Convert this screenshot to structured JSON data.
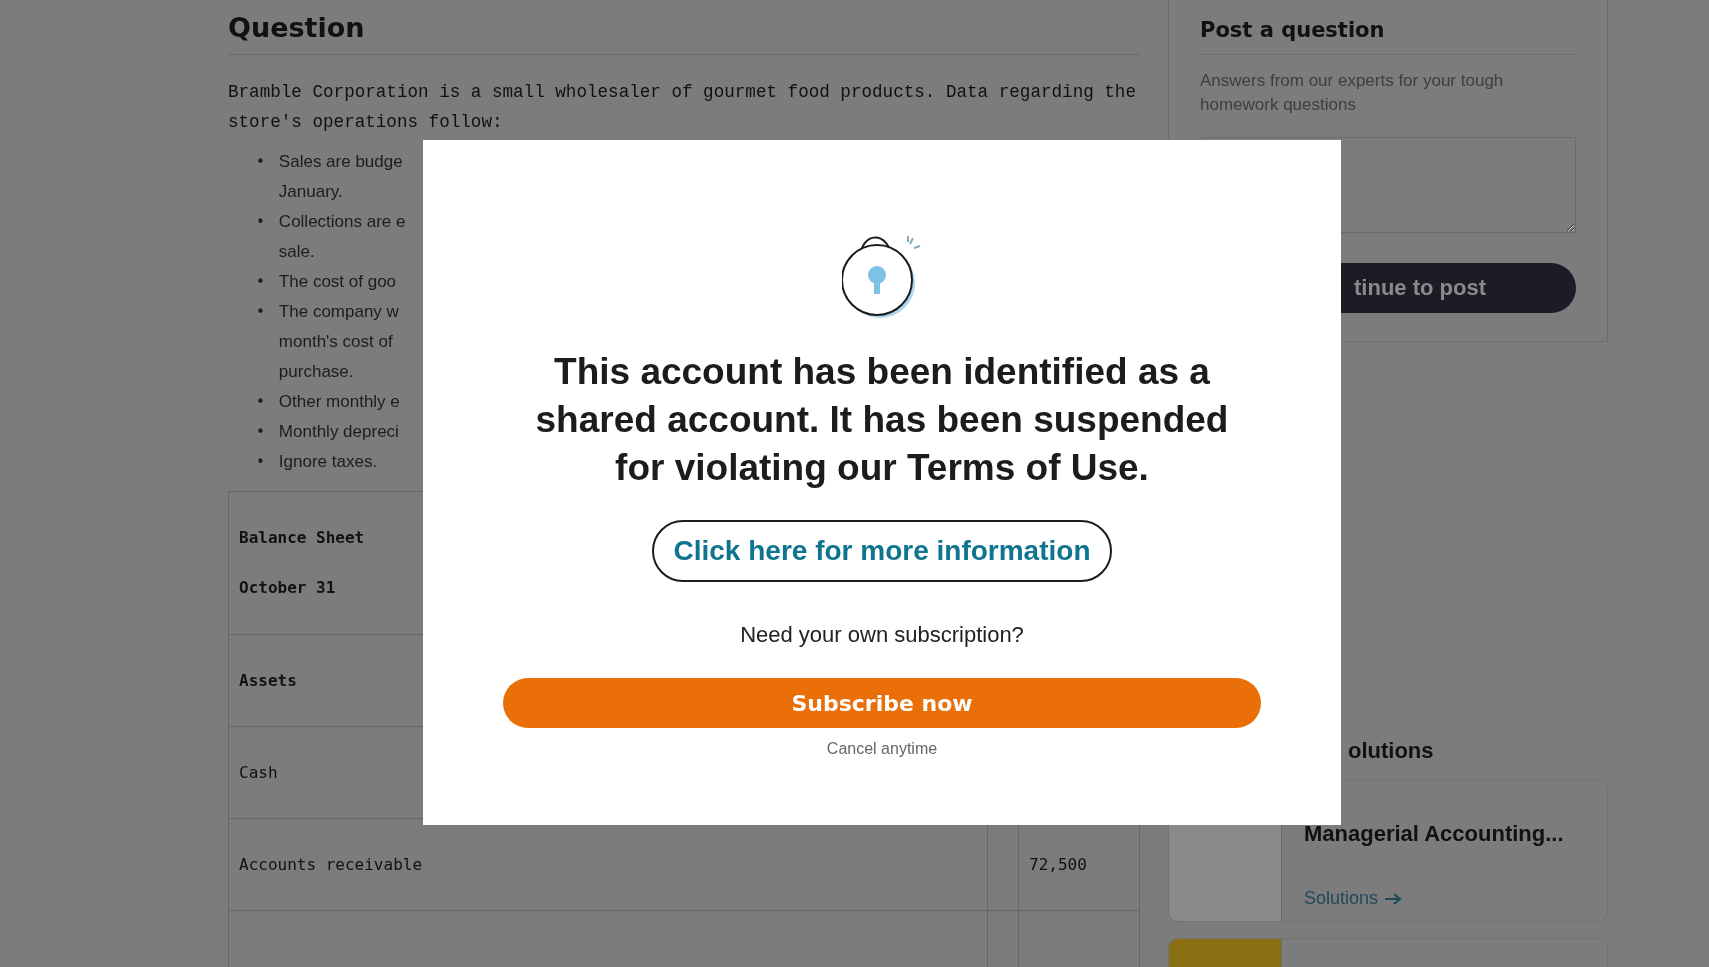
{
  "question": {
    "heading": "Question",
    "intro": "Bramble Corporation is a small wholesaler of gourmet food products. Data regarding the store's  operations follow:",
    "bullets": [
      {
        "marker": "•",
        "lines": [
          "Sales are budge",
          "January."
        ]
      },
      {
        "marker": "•",
        "lines": [
          "Collections are e",
          "sale."
        ]
      },
      {
        "marker": "•",
        "lines": [
          "The cost of goo"
        ]
      },
      {
        "marker": "•",
        "lines": [
          "The company w",
          "month's cost of",
          "purchase."
        ]
      },
      {
        "marker": "•",
        "lines": [
          "Other monthly e"
        ]
      },
      {
        "marker": "•",
        "lines": [
          "Monthly depreci"
        ]
      },
      {
        "marker": "•",
        "lines": [
          "Ignore taxes."
        ]
      }
    ],
    "table": {
      "rows": [
        {
          "lines": [
            "Balance Sheet",
            "October 31"
          ],
          "bold": true,
          "value": ""
        },
        {
          "lines": [
            "Assets"
          ],
          "bold": true,
          "value": ""
        },
        {
          "lines": [
            "Cash"
          ],
          "bold": false,
          "value": ""
        },
        {
          "lines": [
            "Accounts receivable"
          ],
          "bold": false,
          "value": "72,500"
        },
        {
          "lines": [],
          "value": ""
        }
      ]
    }
  },
  "sidebar": {
    "title": "Post a question",
    "subtitle": "Answers from our experts for your tough homework questions",
    "post_button": "tinue to post",
    "solutions_heading": "olutions",
    "books": [
      {
        "kind": "full",
        "title": "Managerial Accounting...",
        "link": "Solutions"
      },
      {
        "kind": "cut_off"
      }
    ]
  },
  "modal": {
    "message": "This account has been identified as a shared account. It has been suspended for violating our Terms of Use.",
    "info_button": "Click here for more information",
    "prompt": "Need your own subscription?",
    "subscribe_button": "Subscribe now",
    "note": "Cancel anytime"
  }
}
